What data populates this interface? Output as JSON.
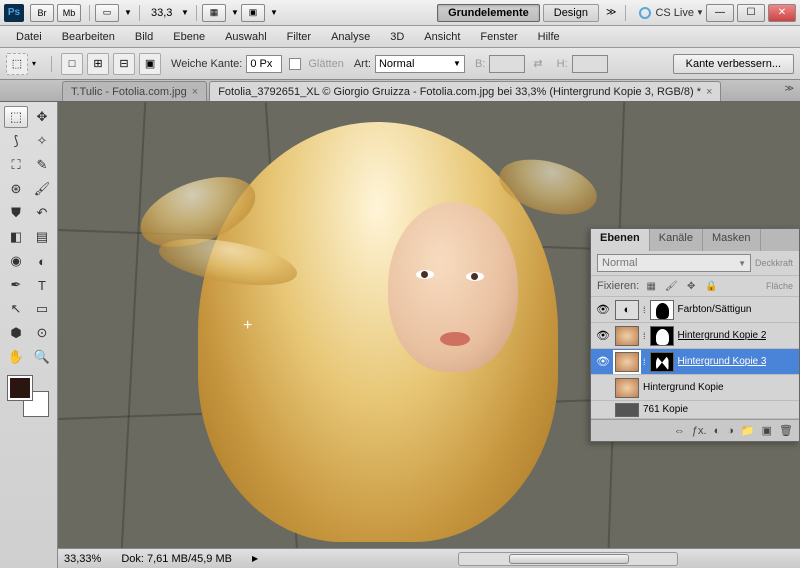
{
  "title": {
    "zoom": "33,3"
  },
  "workspace_switcher": {
    "active": "Grundelemente",
    "inactive": "Design"
  },
  "cslive": "CS Live",
  "menu": [
    "Datei",
    "Bearbeiten",
    "Bild",
    "Ebene",
    "Auswahl",
    "Filter",
    "Analyse",
    "3D",
    "Ansicht",
    "Fenster",
    "Hilfe"
  ],
  "options": {
    "feather_label": "Weiche Kante:",
    "feather_value": "0 Px",
    "antialias_label": "Glätten",
    "style_label": "Art:",
    "style_value": "Normal",
    "width_label": "B:",
    "height_label": "H:",
    "refine": "Kante verbessern..."
  },
  "tabs": {
    "inactive": "T.Tulic - Fotolia.com.jpg",
    "active": "Fotolia_3792651_XL © Giorgio Gruizza - Fotolia.com.jpg bei 33,3% (Hintergrund Kopie 3, RGB/8) *"
  },
  "status": {
    "zoom": "33,33%",
    "doc": "Dok: 7,61 MB/45,9 MB"
  },
  "panels": {
    "tabs": [
      "Ebenen",
      "Kanäle",
      "Masken"
    ],
    "blend": "Normal",
    "opacity_label": "Deckkraft",
    "lock_label": "Fixieren:",
    "fill_label": "Fläche",
    "layers": [
      {
        "name": "Farbton/Sättigun"
      },
      {
        "name": "Hintergrund Kopie 2"
      },
      {
        "name": "Hintergrund Kopie 3"
      },
      {
        "name": "Hintergrund Kopie"
      },
      {
        "name": "761 Kopie"
      }
    ]
  }
}
